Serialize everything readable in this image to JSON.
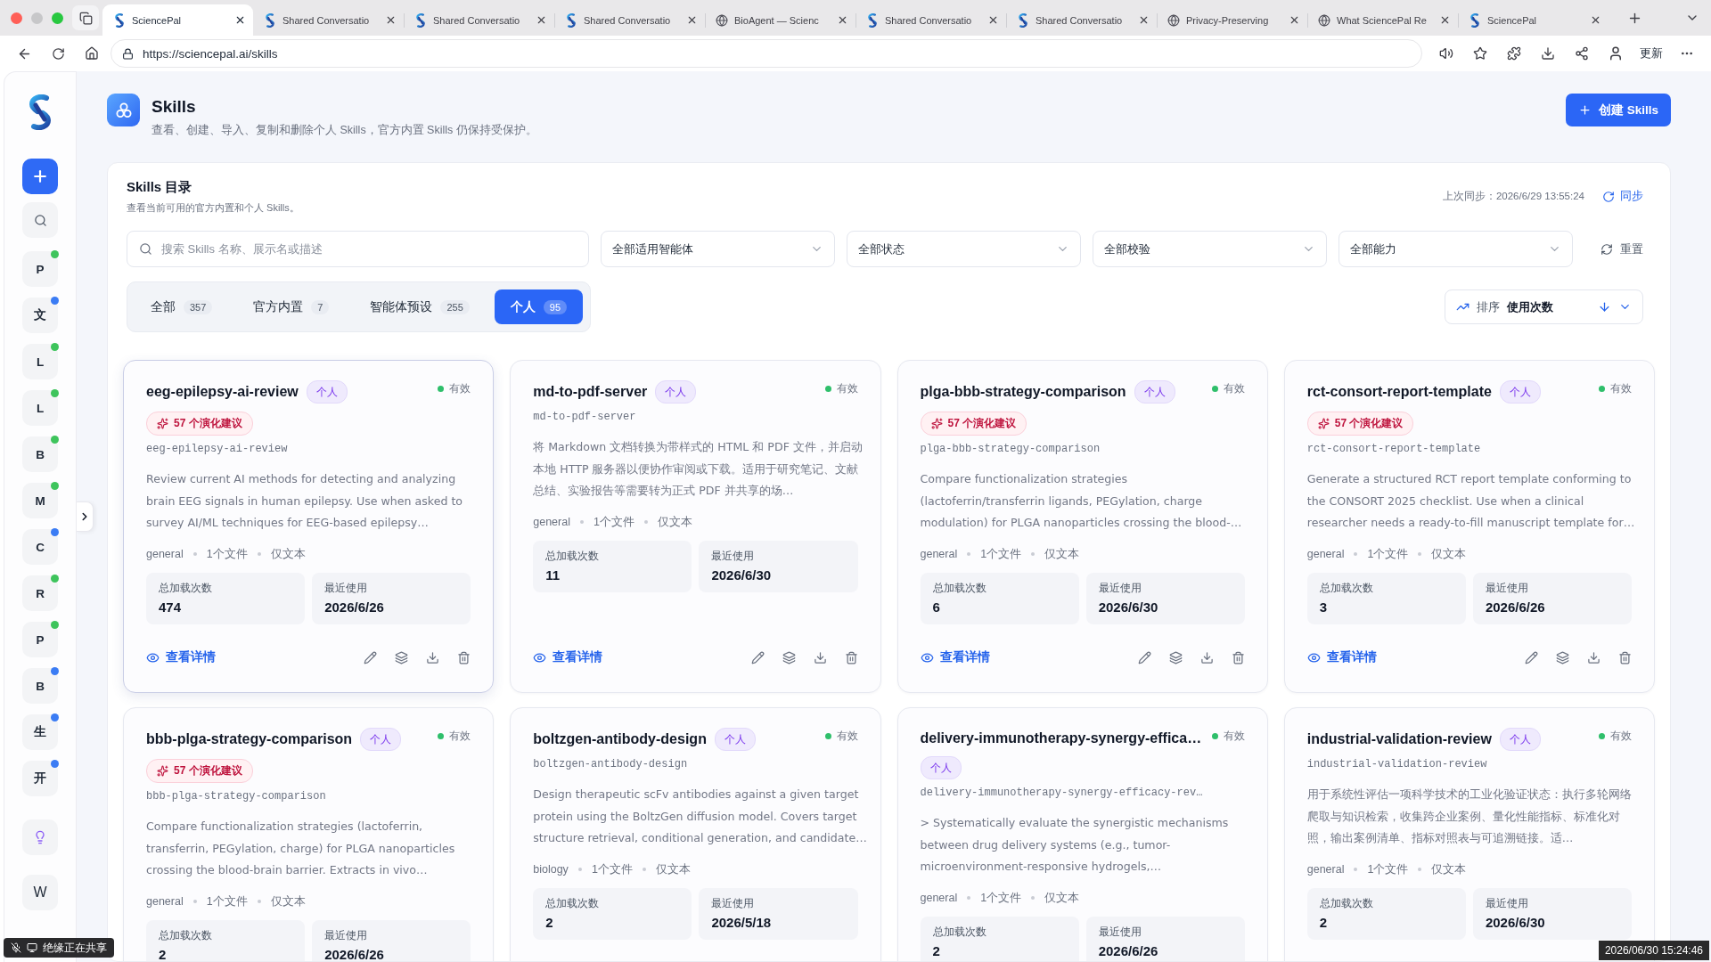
{
  "browser": {
    "tabs": [
      {
        "title": "SciencePal",
        "kind": "logo",
        "selected": true
      },
      {
        "title": "Shared Conversatio",
        "kind": "logo",
        "selected": false
      },
      {
        "title": "Shared Conversatio",
        "kind": "logo",
        "selected": false
      },
      {
        "title": "Shared Conversatio",
        "kind": "logo",
        "selected": false
      },
      {
        "title": "BioAgent — Scienc",
        "kind": "globe",
        "selected": false
      },
      {
        "title": "Shared Conversatio",
        "kind": "logo",
        "selected": false
      },
      {
        "title": "Shared Conversatio",
        "kind": "logo",
        "selected": false
      },
      {
        "title": "Privacy-Preserving",
        "kind": "globe",
        "selected": false
      },
      {
        "title": "What SciencePal Re",
        "kind": "globe",
        "selected": false
      },
      {
        "title": "SciencePal",
        "kind": "logo",
        "selected": false
      }
    ],
    "url": "https://sciencepal.ai/skills",
    "update_button": "更新"
  },
  "sidebar": {
    "items": [
      {
        "label": "P",
        "color": "#3ec45c"
      },
      {
        "label": "文",
        "color": "#3b7cf4"
      },
      {
        "label": "L",
        "color": "#3ec45c"
      },
      {
        "label": "L",
        "color": "#3ec45c"
      },
      {
        "label": "B",
        "color": "#3ec45c"
      },
      {
        "label": "M",
        "color": "#3ec45c"
      },
      {
        "label": "C",
        "color": "#3b7cf4"
      },
      {
        "label": "R",
        "color": "#3ec45c"
      },
      {
        "label": "P",
        "color": "#3ec45c"
      },
      {
        "label": "B",
        "color": "#3b7cf4"
      },
      {
        "label": "生",
        "color": "#3b7cf4"
      },
      {
        "label": "开",
        "color": "#3b7cf4"
      }
    ],
    "account": "W"
  },
  "header": {
    "title": "Skills",
    "subtitle": "查看、创建、导入、复制和删除个人 Skills，官方内置 Skills 仍保持受保护。",
    "create_button": "创建 Skills"
  },
  "catalog": {
    "title": "Skills 目录",
    "subtitle": "查看当前可用的官方内置和个人 Skills。",
    "last_sync": "上次同步：2026/6/29 13:55:24",
    "sync_button": "同步",
    "search": {
      "placeholder": "搜索 Skills 名称、展示名或描述"
    },
    "filters": [
      "全部适用智能体",
      "全部状态",
      "全部校验",
      "全部能力"
    ],
    "reset_button": "重置",
    "tabs": [
      {
        "label": "全部",
        "count": "357",
        "selected": false
      },
      {
        "label": "官方内置",
        "count": "7",
        "selected": false
      },
      {
        "label": "智能体预设",
        "count": "255",
        "selected": false
      },
      {
        "label": "个人",
        "count": "95",
        "selected": true
      }
    ],
    "sort": {
      "label": "排序",
      "value": "使用次数"
    },
    "cards": [
      {
        "name": "eeg-epilepsy-ai-review",
        "badge": "个人",
        "status": "有效",
        "hovered": true,
        "suggestions": "57 个演化建议",
        "slug": "eeg-epilepsy-ai-review",
        "description": "Review current AI methods for detecting and analyzing brain EEG signals in human epilepsy. Use when asked to survey AI/ML techniques for EEG-based epilepsy…",
        "meta": [
          "general",
          "1个文件",
          "仅文本"
        ],
        "stats": [
          {
            "label": "总加载次数",
            "value": "474"
          },
          {
            "label": "最近使用",
            "value": "2026/6/26"
          }
        ],
        "detail_link": "查看详情"
      },
      {
        "name": "md-to-pdf-server",
        "badge": "个人",
        "status": "有效",
        "hovered": false,
        "slug": "md-to-pdf-server",
        "description": "将 Markdown 文档转换为带样式的 HTML 和 PDF 文件，并启动本地 HTTP 服务器以便协作审阅或下载。适用于研究笔记、文献总结、实验报告等需要转为正式 PDF 并共享的场…",
        "meta": [
          "general",
          "1个文件",
          "仅文本"
        ],
        "stats": [
          {
            "label": "总加载次数",
            "value": "11"
          },
          {
            "label": "最近使用",
            "value": "2026/6/30"
          }
        ],
        "detail_link": "查看详情"
      },
      {
        "name": "plga-bbb-strategy-comparison",
        "badge": "个人",
        "status": "有效",
        "hovered": false,
        "suggestions": "57 个演化建议",
        "slug": "plga-bbb-strategy-comparison",
        "description": "Compare functionalization strategies (lactoferrin/transferrin ligands, PEGylation, charge modulation) for PLGA nanoparticles crossing the blood-…",
        "meta": [
          "general",
          "1个文件",
          "仅文本"
        ],
        "stats": [
          {
            "label": "总加载次数",
            "value": "6"
          },
          {
            "label": "最近使用",
            "value": "2026/6/30"
          }
        ],
        "detail_link": "查看详情"
      },
      {
        "name": "rct-consort-report-template",
        "badge": "个人",
        "status": "有效",
        "hovered": false,
        "suggestions": "57 个演化建议",
        "slug": "rct-consort-report-template",
        "description": "Generate a structured RCT report template conforming to the CONSORT 2025 checklist. Use when a clinical researcher needs a ready-to-fill manuscript template for…",
        "meta": [
          "general",
          "1个文件",
          "仅文本"
        ],
        "stats": [
          {
            "label": "总加载次数",
            "value": "3"
          },
          {
            "label": "最近使用",
            "value": "2026/6/26"
          }
        ],
        "detail_link": "查看详情"
      },
      {
        "name": "bbb-plga-strategy-comparison",
        "badge": "个人",
        "status": "有效",
        "hovered": false,
        "suggestions": "57 个演化建议",
        "slug": "bbb-plga-strategy-comparison",
        "description": "Compare functionalization strategies (lactoferrin, transferrin, PEGylation, charge) for PLGA nanoparticles crossing the blood-brain barrier. Extracts in vivo…",
        "meta": [
          "general",
          "1个文件",
          "仅文本"
        ],
        "stats": [
          {
            "label": "总加载次数",
            "value": "2"
          },
          {
            "label": "最近使用",
            "value": "2026/6/26"
          }
        ]
      },
      {
        "name": "boltzgen-antibody-design",
        "badge": "个人",
        "status": "有效",
        "hovered": false,
        "slug": "boltzgen-antibody-design",
        "description": "Design therapeutic scFv antibodies against a given target protein using the BoltzGen diffusion model. Covers target structure retrieval, conditional generation, and candidate…",
        "meta": [
          "biology",
          "1个文件",
          "仅文本"
        ],
        "stats": [
          {
            "label": "总加载次数",
            "value": "2"
          },
          {
            "label": "最近使用",
            "value": "2026/5/18"
          }
        ]
      },
      {
        "name": "delivery-immunotherapy-synergy-effica…",
        "badge": "个人",
        "status": "有效",
        "hovered": false,
        "slug": "delivery-immunotherapy-synergy-efficacy-rev…",
        "description": "> Systematically evaluate the synergistic mechanisms between drug delivery systems (e.g., tumor-microenvironment-responsive hydrogels,…",
        "meta": [
          "general",
          "1个文件",
          "仅文本"
        ],
        "stats": [
          {
            "label": "总加载次数",
            "value": "2"
          },
          {
            "label": "最近使用",
            "value": "2026/6/26"
          }
        ]
      },
      {
        "name": "industrial-validation-review",
        "badge": "个人",
        "status": "有效",
        "hovered": false,
        "slug": "industrial-validation-review",
        "description": "用于系统性评估一项科学技术的工业化验证状态：执行多轮网络爬取与知识检索，收集跨企业案例、量化性能指标、标准化对照，输出案例清单、指标对照表与可追溯链接。适…",
        "meta": [
          "general",
          "1个文件",
          "仅文本"
        ],
        "stats": [
          {
            "label": "总加载次数",
            "value": "2"
          },
          {
            "label": "最近使用",
            "value": "2026/6/30"
          }
        ]
      }
    ]
  },
  "overlays": {
    "screen_share": "绝缘正在共享",
    "timestamp": "2026/06/30 15:24:46"
  }
}
